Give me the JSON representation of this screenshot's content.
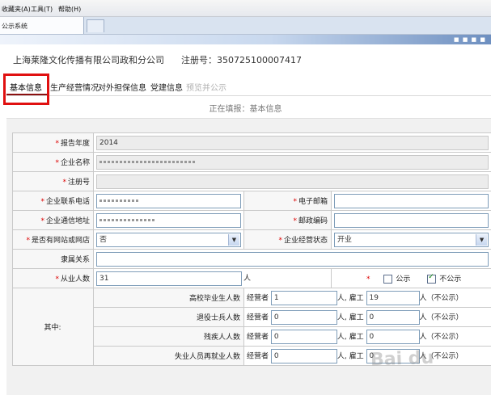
{
  "menu": {
    "items": [
      "收藏夹(A)",
      "工具(T)",
      "帮助(H)"
    ]
  },
  "browser_tab": {
    "title": "公示系统"
  },
  "header": {
    "company": "上海莱隆文化传播有限公司政和分公司",
    "reg_label_value": "注册号：350725100007417"
  },
  "form_tabs": [
    {
      "label": "基本信息",
      "state": "active"
    },
    {
      "label": "生产经营情况",
      "state": "normal"
    },
    {
      "label": "对外担保信息",
      "state": "normal"
    },
    {
      "label": "党建信息",
      "state": "normal"
    },
    {
      "label": "预览并公示",
      "state": "disabled"
    }
  ],
  "status": "正在填报：基本信息",
  "required_mark": "*",
  "fields": {
    "report_year": {
      "label": "报告年度",
      "value": "2014"
    },
    "company_name": {
      "label": "企业名称",
      "value": ""
    },
    "reg_no": {
      "label": "注册号",
      "value": ""
    },
    "phone": {
      "label": "企业联系电话",
      "value": ""
    },
    "email": {
      "label": "电子邮箱",
      "value": ""
    },
    "address": {
      "label": "企业通信地址",
      "value": ""
    },
    "postcode": {
      "label": "邮政编码",
      "value": ""
    },
    "website": {
      "label": "是否有网站或网店",
      "value": "否"
    },
    "biz_status": {
      "label": "企业经营状态",
      "value": "开业"
    },
    "affiliation": {
      "label": "隶属关系",
      "value": ""
    },
    "employees": {
      "label": "从业人数",
      "value": "31",
      "unit": "人"
    },
    "publicity": {
      "public_label": "公示",
      "private_label": "不公示",
      "selected": "不公示"
    }
  },
  "breakdown": {
    "label": "其中:",
    "operator_label": "经营者",
    "employee_label": "雇工",
    "unit": "人",
    "suffix": "人（不公示）",
    "rows": [
      {
        "label": "高校毕业生人数",
        "operator": "1",
        "employee": "19"
      },
      {
        "label": "退役士兵人数",
        "operator": "0",
        "employee": "0"
      },
      {
        "label": "残疾人人数",
        "operator": "0",
        "employee": "0"
      },
      {
        "label": "失业人员再就业人数",
        "operator": "0",
        "employee": "0"
      }
    ]
  },
  "watermark": "Bai du"
}
